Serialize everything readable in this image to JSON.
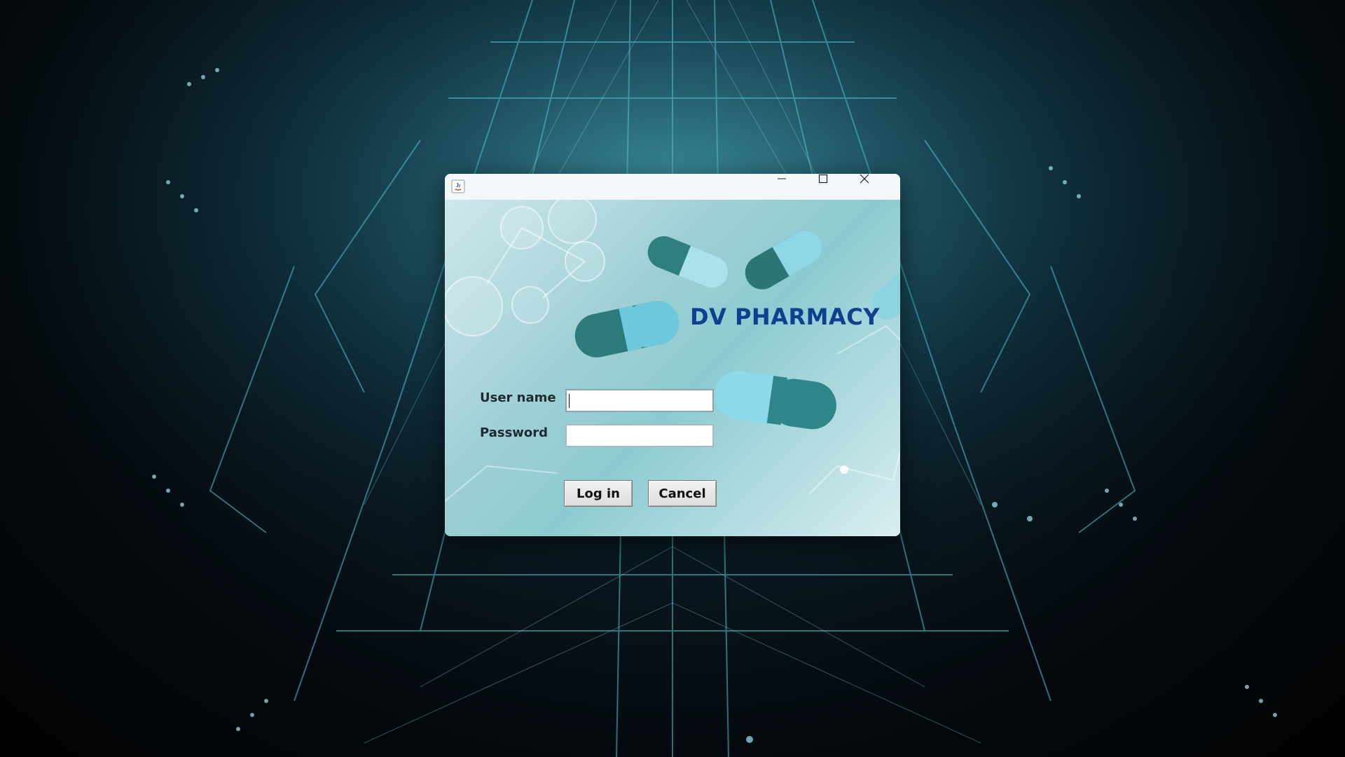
{
  "colors": {
    "brand": "#0f3f8f",
    "label": "#1f2a30",
    "desktop_bg": "#04090d",
    "window_bg": "#f4f7f9",
    "accent_teal": "#3fb3c2"
  },
  "window": {
    "title": "",
    "app_icon": "java-icon",
    "controls": {
      "minimize_icon": "minimize-icon",
      "maximize_icon": "maximize-icon",
      "close_icon": "close-icon"
    }
  },
  "brand": {
    "title": "DV PHARMACY"
  },
  "form": {
    "username_label": "User name",
    "username_value": "",
    "password_label": "Password",
    "password_value": ""
  },
  "buttons": {
    "login_label": "Log in",
    "cancel_label": "Cancel"
  }
}
